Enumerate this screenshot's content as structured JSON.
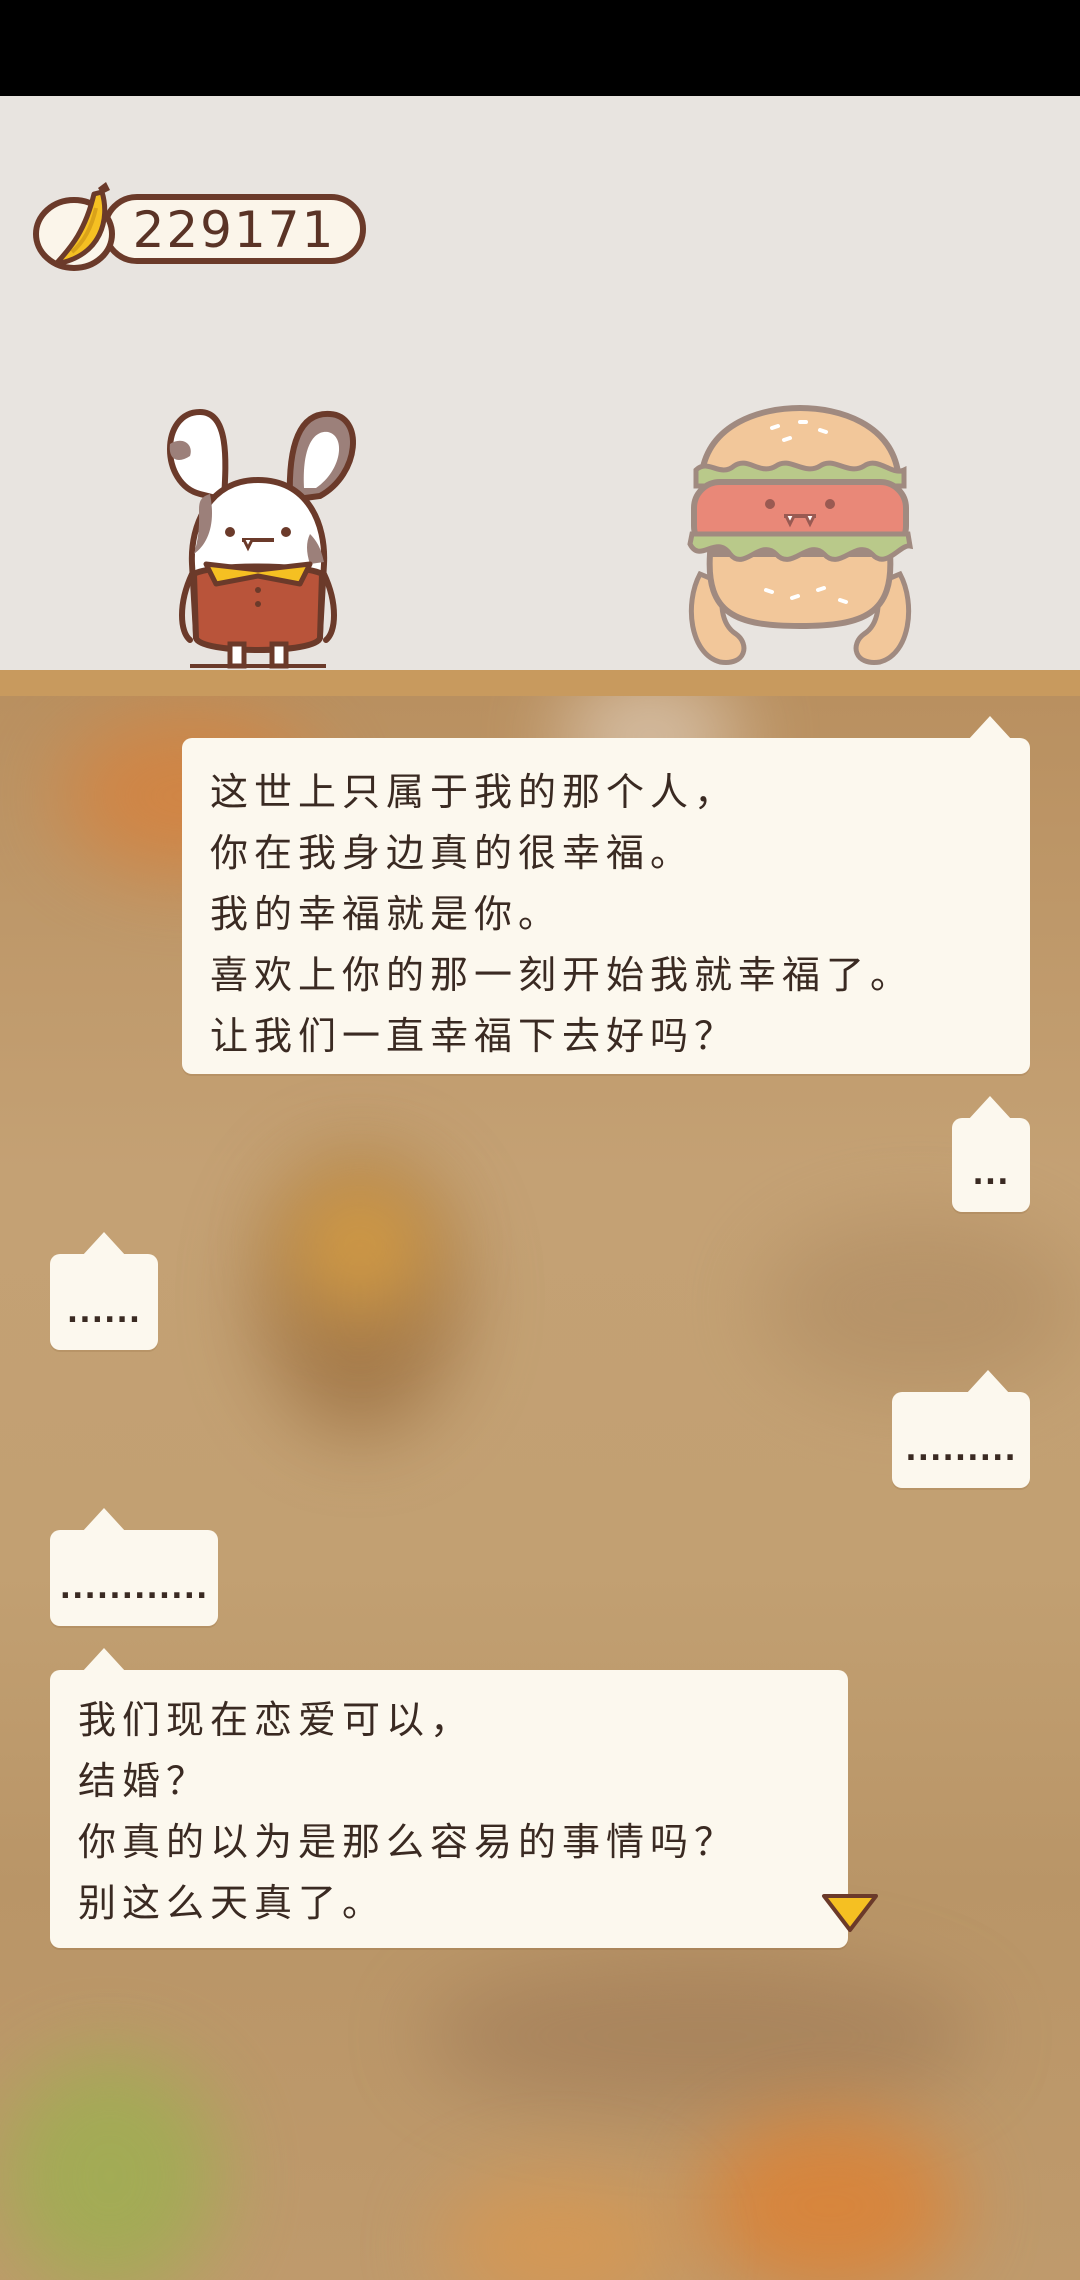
{
  "currency": {
    "icon": "banana-icon",
    "value": "229171"
  },
  "characters": {
    "left": "bunny-character",
    "right": "hamburger-character"
  },
  "dialogue": [
    {
      "speaker": "right",
      "text": "这世上只属于我的那个人，\n你在我身边真的很幸福。\n我的幸福就是你。\n喜欢上你的那一刻开始我就幸福了。\n让我们一直幸福下去好吗？"
    },
    {
      "speaker": "right",
      "text": "..."
    },
    {
      "speaker": "left",
      "text": "......"
    },
    {
      "speaker": "right",
      "text": "........."
    },
    {
      "speaker": "left",
      "text": "............"
    },
    {
      "speaker": "left",
      "text": "我们现在恋爱可以，\n结婚？\n你真的以为是那么容易的事情吗？\n别这么天真了。"
    }
  ],
  "colors": {
    "bubble": "#fcf8ee",
    "accent": "#f5c022",
    "outline": "#6b3a2a"
  }
}
